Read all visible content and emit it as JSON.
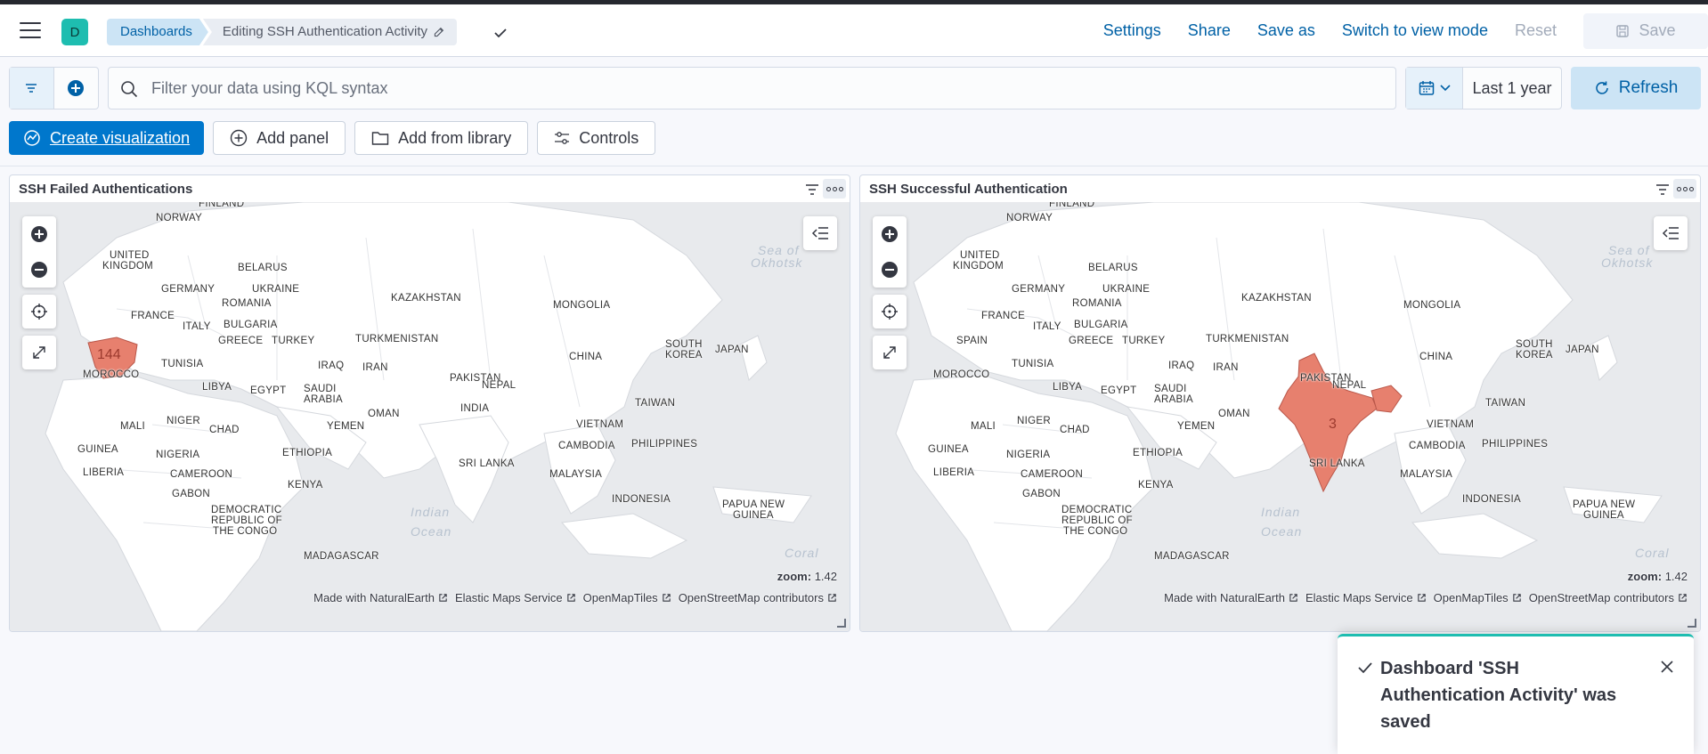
{
  "header": {
    "space_initial": "D",
    "breadcrumbs": [
      "Dashboards",
      "Editing SSH Authentication Activity"
    ],
    "links": {
      "settings": "Settings",
      "share": "Share",
      "save_as": "Save as",
      "switch_mode": "Switch to view mode",
      "reset": "Reset",
      "save": "Save"
    }
  },
  "query": {
    "placeholder": "Filter your data using KQL syntax",
    "date_range": "Last 1 year",
    "refresh": "Refresh"
  },
  "toolbar": {
    "create": "Create visualization",
    "add_panel": "Add panel",
    "add_library": "Add from library",
    "controls": "Controls"
  },
  "map_labels": {
    "norway": "NORWAY",
    "finland": "FINLAND",
    "uk1": "UNITED",
    "uk2": "KINGDOM",
    "belarus": "BELARUS",
    "germany": "GERMANY",
    "ukraine": "UKRAINE",
    "kazakhstan": "KAZAKHSTAN",
    "mongolia": "MONGOLIA",
    "france": "FRANCE",
    "romania": "ROMANIA",
    "italy": "ITALY",
    "bulgaria": "BULGARIA",
    "spain": "SPAIN",
    "greece": "GREECE",
    "turkey": "TURKEY",
    "turkmenistan": "TURKMENISTAN",
    "china": "CHINA",
    "skorea1": "SOUTH",
    "skorea2": "KOREA",
    "japan": "JAPAN",
    "tunisia": "TUNISIA",
    "iraq": "IRAQ",
    "iran": "IRAN",
    "pakistan": "PAKISTAN",
    "nepal": "NEPAL",
    "morocco": "MOROCCO",
    "libya": "LIBYA",
    "egypt": "EGYPT",
    "saudi1": "SAUDI",
    "saudi2": "ARABIA",
    "taiwan": "TAIWAN",
    "india": "INDIA",
    "oman": "OMAN",
    "mali": "MALI",
    "niger": "NIGER",
    "chad": "CHAD",
    "yemen": "YEMEN",
    "vietnam": "VIETNAM",
    "guinea": "GUINEA",
    "nigeria": "NIGERIA",
    "ethiopia": "ETHIOPIA",
    "cambodia": "CAMBODIA",
    "philippines": "PHILIPPINES",
    "srilanka": "SRI LANKA",
    "liberia": "LIBERIA",
    "cameroon": "CAMEROON",
    "malaysia": "MALAYSIA",
    "kenya": "KENYA",
    "gabon": "GABON",
    "indonesia": "INDONESIA",
    "drc1": "DEMOCRATIC",
    "drc2": "REPUBLIC OF",
    "drc3": "THE CONGO",
    "png1": "PAPUA NEW",
    "png2": "GUINEA",
    "madagascar": "MADAGASCAR",
    "sea_okhotsk1": "Sea of",
    "sea_okhotsk2": "Okhotsk",
    "indian1": "Indian",
    "indian2": "Ocean",
    "coral": "Coral"
  },
  "panels": [
    {
      "title": "SSH Failed Authentications",
      "zoom_label": "zoom:",
      "zoom_value": "1.42",
      "highlight_country": "Spain",
      "count": "144",
      "attribution": [
        "Made with NaturalEarth",
        "Elastic Maps Service",
        "OpenMapTiles",
        "OpenStreetMap contributors"
      ]
    },
    {
      "title": "SSH Successful Authentication",
      "zoom_label": "zoom:",
      "zoom_value": "1.42",
      "highlight_country": "India",
      "count": "3",
      "attribution": [
        "Made with NaturalEarth",
        "Elastic Maps Service",
        "OpenMapTiles",
        "OpenStreetMap contributors"
      ]
    }
  ],
  "toast": {
    "message": "Dashboard 'SSH Authentication Activity' was saved"
  },
  "colors": {
    "primary": "#0077cc",
    "highlight_fill": "#e7806e",
    "toast_accent": "#1ebdb0"
  }
}
